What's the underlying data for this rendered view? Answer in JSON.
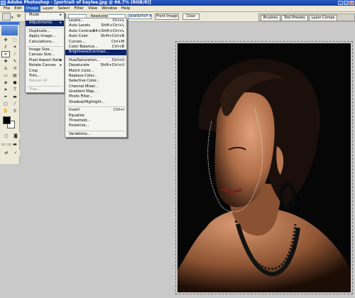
{
  "window": {
    "title": "Adobe Photoshop - [portrait of kaylee.jpg @ 66.7% (RGB/8)]",
    "buttons": [
      "_",
      "□",
      "×"
    ]
  },
  "menubar": {
    "items": [
      "File",
      "Edit",
      "Image",
      "Layer",
      "Select",
      "Filter",
      "View",
      "Window",
      "Help"
    ]
  },
  "options": {
    "w_label": "W",
    "resolution_label": "Resolution:",
    "units_value": "pixels/inch",
    "front_image_label": "Front Image",
    "clear_label": "Clear"
  },
  "palette_well": {
    "tabs": [
      "Brushes",
      "Tool Presets",
      "Layer Comps"
    ]
  },
  "image_menu": {
    "mode": "Mode",
    "adjustments": "Adjustments",
    "duplicate": "Duplicate...",
    "apply_image": "Apply Image...",
    "calculations": "Calculations...",
    "image_size": "Image Size...",
    "canvas_size": "Canvas Size...",
    "pixel_aspect_ratio": "Pixel Aspect Ratio",
    "rotate_canvas": "Rotate Canvas",
    "crop": "Crop",
    "trim": "Trim...",
    "reveal_all": "Reveal All",
    "trap": "Trap..."
  },
  "adjustments_menu": [
    {
      "label": "Levels...",
      "shortcut": "Ctrl+L"
    },
    {
      "label": "Auto Levels",
      "shortcut": "Shift+Ctrl+L"
    },
    {
      "label": "Auto Contrast",
      "shortcut": "Alt+Shift+Ctrl+L"
    },
    {
      "label": "Auto Color",
      "shortcut": "Shift+Ctrl+B"
    },
    {
      "label": "Curves...",
      "shortcut": "Ctrl+M"
    },
    {
      "label": "Color Balance...",
      "shortcut": "Ctrl+B"
    },
    {
      "label": "Brightness/Contrast...",
      "shortcut": ""
    },
    {
      "label": "Hue/Saturation...",
      "shortcut": "Ctrl+U"
    },
    {
      "label": "Desaturate",
      "shortcut": "Shift+Ctrl+U"
    },
    {
      "label": "Match Color...",
      "shortcut": ""
    },
    {
      "label": "Replace Color...",
      "shortcut": ""
    },
    {
      "label": "Selective Color...",
      "shortcut": ""
    },
    {
      "label": "Channel Mixer...",
      "shortcut": ""
    },
    {
      "label": "Gradient Map...",
      "shortcut": ""
    },
    {
      "label": "Photo Filter...",
      "shortcut": ""
    },
    {
      "label": "Shadow/Highlight...",
      "shortcut": ""
    },
    {
      "label": "Invert",
      "shortcut": "Ctrl+I"
    },
    {
      "label": "Equalize",
      "shortcut": ""
    },
    {
      "label": "Threshold...",
      "shortcut": ""
    },
    {
      "label": "Posterize...",
      "shortcut": ""
    },
    {
      "label": "Variations...",
      "shortcut": ""
    }
  ],
  "colors": {
    "menu_highlight": "#0a246a",
    "title_bar": "#1c3f9c",
    "ui_gray": "#ece9d8"
  }
}
